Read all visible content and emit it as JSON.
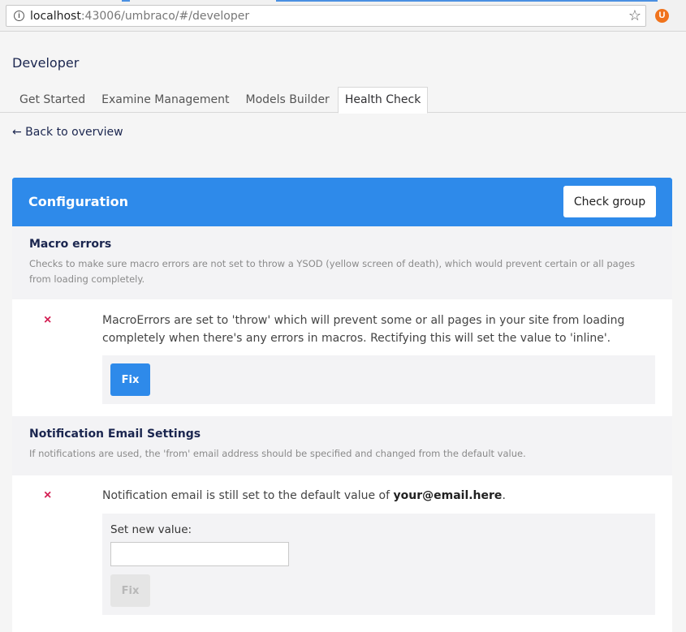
{
  "browser": {
    "url_host": "localhost",
    "url_rest": ":43006/umbraco/#/developer",
    "info_glyph": "i",
    "star_glyph": "☆",
    "extension_glyph": "U",
    "accent_color": "#4a90e2"
  },
  "header": {
    "title": "Developer",
    "tabs": [
      {
        "label": "Get Started",
        "active": false
      },
      {
        "label": "Examine Management",
        "active": false
      },
      {
        "label": "Models Builder",
        "active": false
      },
      {
        "label": "Health Check",
        "active": true
      }
    ]
  },
  "back_link": "← Back to overview",
  "group": {
    "title": "Configuration",
    "check_group_label": "Check group",
    "color": "#2e8aea",
    "checks": [
      {
        "name": "Macro errors",
        "description": "Checks to make sure macro errors are not set to throw a YSOD (yellow screen of death), which would prevent certain or all pages from loading completely.",
        "status_icon": "×",
        "status": "error",
        "message": "MacroErrors are set to 'throw' which will prevent some or all pages in your site from loading completely when there's any errors in macros. Rectifying this will set the value to 'inline'.",
        "fix_label": "Fix"
      },
      {
        "name": "Notification Email Settings",
        "description": "If notifications are used, the 'from' email address should be specified and changed from the default value.",
        "status_icon": "×",
        "status": "error",
        "message_prefix": "Notification email is still set to the default value of ",
        "message_value": "your@email.here",
        "message_suffix": ".",
        "set_value_label": "Set new value:",
        "input_value": "",
        "fix_label": "Fix"
      }
    ]
  }
}
